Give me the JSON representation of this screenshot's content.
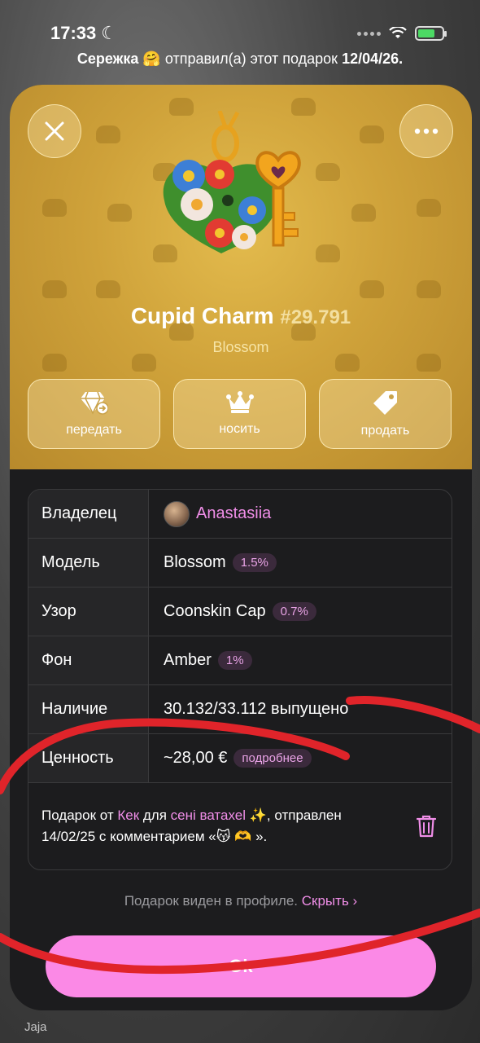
{
  "status_bar": {
    "time": "17:33",
    "moon": "☾"
  },
  "sender_line": {
    "name": "Сережка",
    "emoji": "🤗",
    "text": "отправил(а) этот подарок",
    "date": "12/04/26."
  },
  "gift": {
    "name": "Cupid Charm",
    "number": "#29.791",
    "model": "Blossom",
    "art_icon": "flower-heart-key-icon"
  },
  "actions": [
    {
      "label": "передать",
      "icon": "diamond-transfer-icon"
    },
    {
      "label": "носить",
      "icon": "crown-icon"
    },
    {
      "label": "продать",
      "icon": "price-tag-icon"
    }
  ],
  "details": {
    "owner": {
      "key": "Владелец",
      "value": "Anastasiia"
    },
    "model": {
      "key": "Модель",
      "value": "Blossom",
      "badge": "1.5%"
    },
    "pattern": {
      "key": "Узор",
      "value": "Coonskin Cap",
      "badge": "0.7%"
    },
    "background": {
      "key": "Фон",
      "value": "Amber",
      "badge": "1%"
    },
    "availability": {
      "key": "Наличие",
      "value": "30.132/33.112 выпущено"
    },
    "value": {
      "key": "Ценность",
      "value": "~28,00 €",
      "badge": "подробнее"
    }
  },
  "comment": {
    "prefix": "Подарок от",
    "from": "Кек",
    "mid": "для",
    "to": "ceнi ватахеl ✨",
    "line2": ", отправлен 14/02/25 с комментарием «😽",
    "line3": "🫶 »."
  },
  "visibility": {
    "text": "Подарок виден в профиле.",
    "link": "Скрыть ›"
  },
  "ok_button": "Ok",
  "bottom_peek": "Jaja",
  "colors": {
    "accent_pink": "#f08ee8",
    "button_pink": "#fb89e6",
    "gold": "#cfa23a",
    "scribble_red": "#e0242a"
  }
}
